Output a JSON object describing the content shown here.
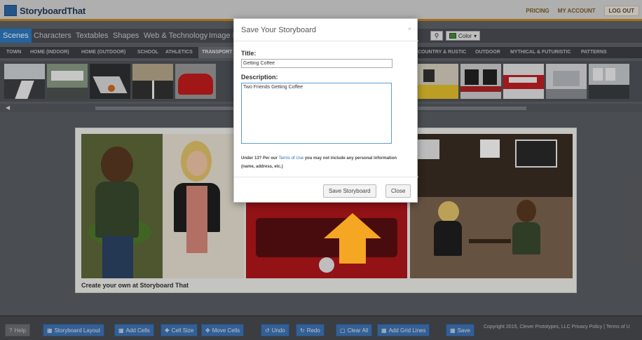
{
  "app": {
    "logo_text": "StoryboardThat"
  },
  "top_nav": {
    "pricing": "PRICING",
    "my_account": "MY ACCOUNT",
    "logout": "LOG OUT"
  },
  "menu": {
    "items": [
      "Scenes",
      "Characters",
      "Textables",
      "Shapes",
      "Web & Technology",
      "Image P"
    ],
    "color_label": "Color"
  },
  "subcategories": {
    "left": [
      "TOWN",
      "HOME (INDOOR)",
      "HOME (OUTDOOR)",
      "SCHOOL",
      "ATHLETICS",
      "TRANSPORT"
    ],
    "right": [
      "COUNTRY & RUSTIC",
      "OUTDOOR",
      "MYTHICAL & FUTURISTIC",
      "PATTERNS"
    ]
  },
  "storyboard": {
    "caption": "Create your own at Storyboard That"
  },
  "modal": {
    "title": "Save Your Storyboard",
    "close": "×",
    "title_label": "Title:",
    "title_value": "Getting Coffee",
    "description_label": "Description:",
    "description_value": "Two Friends Getting Coffee",
    "note_prefix": "Under 13? Per our",
    "note_link": "Terms of Use",
    "note_suffix": "you may not include any personal information (name, address, etc.)",
    "save_button": "Save Storyboard",
    "close_button": "Close"
  },
  "bottom_toolbar": {
    "help": "Help",
    "storyboard_layout": "Storyboard Layout",
    "add_cells": "Add Cells",
    "cell_size": "Cell Size",
    "move_cells": "Move Cells",
    "undo": "Undo",
    "redo": "Redo",
    "clear_all": "Clear All",
    "add_grid_lines": "Add Grid Lines",
    "save": "Save",
    "copyright": "Copyright 2015, Clever Prototypes, LLC  Privacy Policy | Terms of U"
  },
  "colors": {
    "brand_blue": "#2b79c2",
    "top_accent": "#c7891f",
    "arrow_orange": "#f5a623",
    "bus_red": "#b3161c"
  },
  "icons": [
    "search-icon",
    "palette-icon",
    "help-icon",
    "layout-icon",
    "grid-icon",
    "resize-icon",
    "move-icon",
    "undo-icon",
    "redo-icon",
    "trash-icon",
    "grid-lines-icon",
    "save-icon",
    "close-icon",
    "scroll-left-icon",
    "arrow-up-icon"
  ]
}
